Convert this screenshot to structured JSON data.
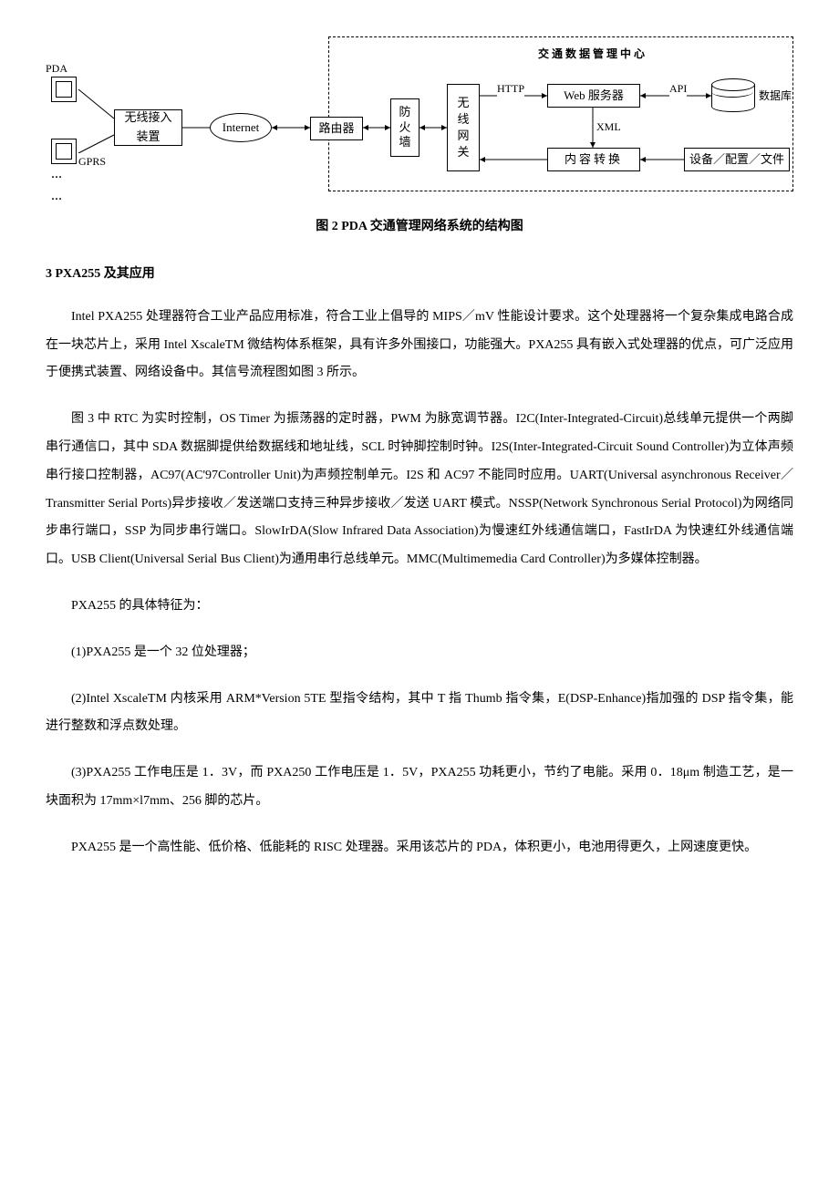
{
  "diagram": {
    "pda": "PDA",
    "gprs": "GPRS",
    "dots": "…",
    "wireless_access": "无线接入\n装置",
    "internet": "Internet",
    "router": "路由器",
    "firewall": "防\n火\n墙",
    "wireless_gateway": "无\n线\n网\n关",
    "center_title": "交通数据管理中心",
    "web_server": "Web 服务器",
    "database": "数据库",
    "content_convert": "内容转换",
    "device_config": "设备／配置／文件",
    "http": "HTTP",
    "api": "API",
    "xml": "XML",
    "caption": "图 2 PDA 交通管理网络系统的结构图"
  },
  "section_title": "3 PXA255 及其应用",
  "paragraphs": {
    "p1": "Intel PXA255 处理器符合工业产品应用标准，符合工业上倡导的 MIPS／mV 性能设计要求。这个处理器将一个复杂集成电路合成在一块芯片上，采用 Intel XscaleTM 微结构体系框架，具有许多外围接口，功能强大。PXA255 具有嵌入式处理器的优点，可广泛应用于便携式装置、网络设备中。其信号流程图如图 3 所示。",
    "p2": "图 3 中 RTC 为实时控制，OS Timer 为振荡器的定时器，PWM 为脉宽调节器。I2C(Inter-Integrated-Circuit)总线单元提供一个两脚串行通信口，其中 SDA 数据脚提供给数据线和地址线，SCL 时钟脚控制时钟。I2S(Inter-Integrated-Circuit Sound Controller)为立体声频串行接口控制器，AC97(AC'97Controller Unit)为声频控制单元。I2S 和 AC97 不能同时应用。UART(Universal asynchronous Receiver／Transmitter Serial Ports)异步接收／发送端口支持三种异步接收／发送 UART 模式。NSSP(Network Synchronous Serial Protocol)为网络同步串行端口，SSP 为同步串行端口。SlowIrDA(Slow Infrared Data Association)为慢速红外线通信端口，FastIrDA 为快速红外线通信端口。USB Client(Universal Serial Bus Client)为通用串行总线单元。MMC(Multimemedia Card Controller)为多媒体控制器。",
    "p3": "PXA255 的具体特征为：",
    "p4": "(1)PXA255 是一个 32 位处理器；",
    "p5": "(2)Intel XscaleTM 内核采用 ARM*Version 5TE 型指令结构，其中 T 指 Thumb 指令集，E(DSP-Enhance)指加强的 DSP 指令集，能进行整数和浮点数处理。",
    "p6": "(3)PXA255 工作电压是 1．3V，而 PXA250 工作电压是 1．5V，PXA255 功耗更小，节约了电能。采用 0．18μm 制造工艺，是一块面积为 17mm×l7mm、256 脚的芯片。",
    "p7": "PXA255 是一个高性能、低价格、低能耗的 RISC 处理器。采用该芯片的 PDA，体积更小，电池用得更久，上网速度更快。"
  }
}
